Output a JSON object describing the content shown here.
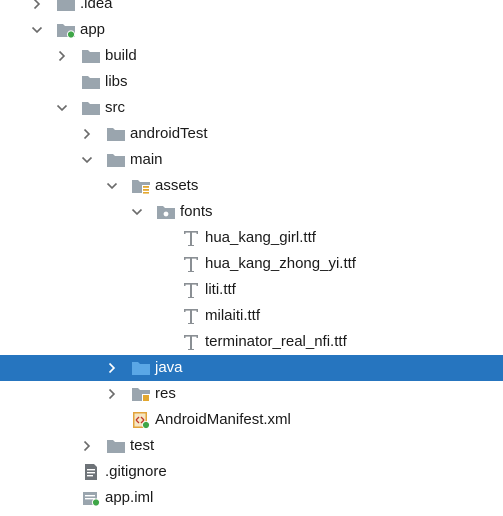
{
  "colors": {
    "selection": "#2675BF",
    "folder": "#9AA5AE",
    "folder_blue": "#5AA7E6",
    "chevron": "#6B6B6B"
  },
  "tree": [
    {
      "label": ".idea",
      "depth": 0,
      "chevron": "right",
      "icon": "folder-icon"
    },
    {
      "label": "app",
      "depth": 0,
      "chevron": "down",
      "icon": "module-folder-icon"
    },
    {
      "label": "build",
      "depth": 1,
      "chevron": "right",
      "icon": "folder-icon"
    },
    {
      "label": "libs",
      "depth": 1,
      "chevron": "none",
      "icon": "folder-icon"
    },
    {
      "label": "src",
      "depth": 1,
      "chevron": "down",
      "icon": "folder-icon"
    },
    {
      "label": "androidTest",
      "depth": 2,
      "chevron": "right",
      "icon": "folder-icon"
    },
    {
      "label": "main",
      "depth": 2,
      "chevron": "down",
      "icon": "folder-icon"
    },
    {
      "label": "assets",
      "depth": 3,
      "chevron": "down",
      "icon": "assets-folder-icon"
    },
    {
      "label": "fonts",
      "depth": 4,
      "chevron": "down",
      "icon": "package-folder-icon"
    },
    {
      "label": "hua_kang_girl.ttf",
      "depth": 5,
      "chevron": "none",
      "icon": "font-file-icon"
    },
    {
      "label": "hua_kang_zhong_yi.ttf",
      "depth": 5,
      "chevron": "none",
      "icon": "font-file-icon"
    },
    {
      "label": "liti.ttf",
      "depth": 5,
      "chevron": "none",
      "icon": "font-file-icon"
    },
    {
      "label": "milaiti.ttf",
      "depth": 5,
      "chevron": "none",
      "icon": "font-file-icon"
    },
    {
      "label": "terminator_real_nfi.ttf",
      "depth": 5,
      "chevron": "none",
      "icon": "font-file-icon"
    },
    {
      "label": "java",
      "depth": 3,
      "chevron": "right",
      "icon": "source-folder-icon",
      "selected": true
    },
    {
      "label": "res",
      "depth": 3,
      "chevron": "right",
      "icon": "resource-folder-icon"
    },
    {
      "label": "AndroidManifest.xml",
      "depth": 3,
      "chevron": "none",
      "icon": "manifest-file-icon"
    },
    {
      "label": "test",
      "depth": 2,
      "chevron": "right",
      "icon": "folder-icon"
    },
    {
      "label": ".gitignore",
      "depth": 1,
      "chevron": "none",
      "icon": "text-file-icon"
    },
    {
      "label": "app.iml",
      "depth": 1,
      "chevron": "none",
      "icon": "module-file-icon"
    }
  ]
}
